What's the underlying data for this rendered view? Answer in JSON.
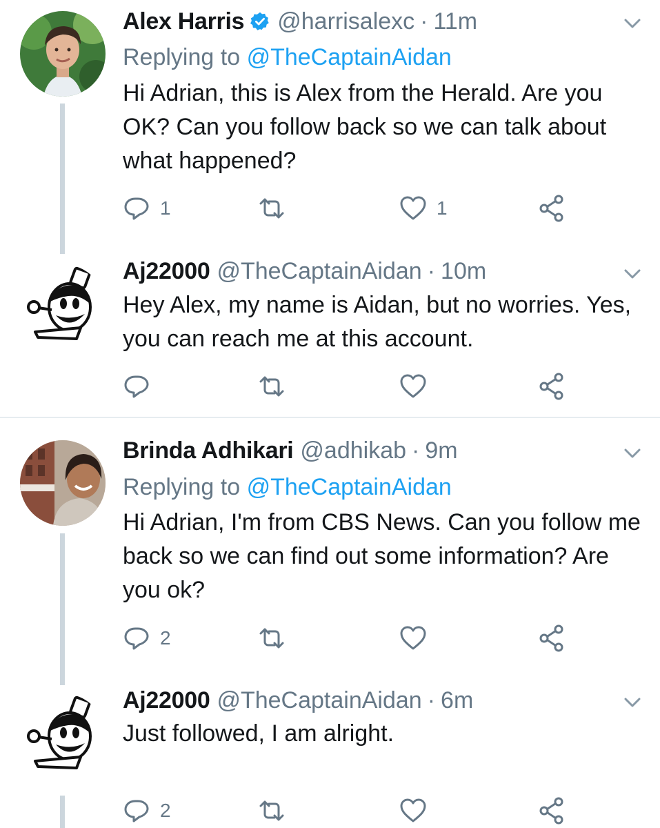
{
  "tweets": [
    {
      "name": "Alex Harris",
      "verified": true,
      "handle": "@harrisalexc",
      "separator": "·",
      "time": "11m",
      "replying_prefix": "Replying to",
      "replying_to": "@TheCaptainAidan",
      "text": "Hi Adrian, this is Alex from the Herald. Are you OK? Can you follow back so we can talk about what happened?",
      "reply_count": "1",
      "retweet_count": "",
      "like_count": "1"
    },
    {
      "name": "Aj22000",
      "verified": false,
      "handle": "@TheCaptainAidan",
      "separator": "·",
      "time": "10m",
      "text": "Hey Alex, my name is Aidan, but no worries. Yes, you can reach me at this account.",
      "reply_count": "",
      "retweet_count": "",
      "like_count": ""
    },
    {
      "name": "Brinda Adhikari",
      "verified": false,
      "handle": "@adhikab",
      "separator": "·",
      "time": "9m",
      "replying_prefix": "Replying to",
      "replying_to": "@TheCaptainAidan",
      "text": "Hi Adrian, I'm from CBS News. Can you follow me back so we can find out some information? Are you ok?",
      "reply_count": "2",
      "retweet_count": "",
      "like_count": ""
    },
    {
      "name": "Aj22000",
      "verified": false,
      "handle": "@TheCaptainAidan",
      "separator": "·",
      "time": "6m",
      "text": "Just followed, I am alright.",
      "reply_count": "2",
      "retweet_count": "",
      "like_count": ""
    }
  ],
  "icons": {
    "reply": "reply-icon",
    "retweet": "retweet-icon",
    "like": "heart-icon",
    "share": "share-icon",
    "menu": "chevron-down-icon",
    "verified": "verified-badge-icon"
  },
  "colors": {
    "text": "#14171a",
    "secondary": "#657786",
    "link": "#1da1f2",
    "thread_line": "#ccd6dd",
    "divider": "#e6ecf0"
  }
}
